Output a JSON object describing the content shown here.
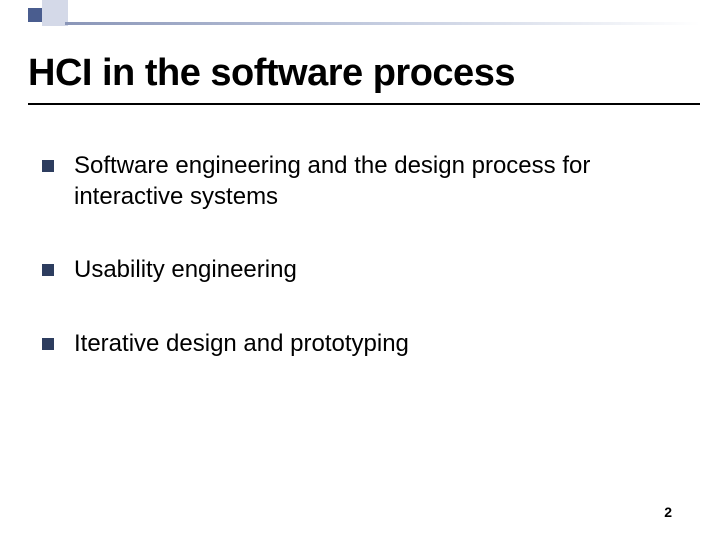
{
  "slide": {
    "title": "HCI in the software process",
    "bullets": [
      "Software engineering and the design process for interactive systems",
      "Usability engineering",
      "Iterative design and prototyping"
    ],
    "page_number": "2"
  }
}
